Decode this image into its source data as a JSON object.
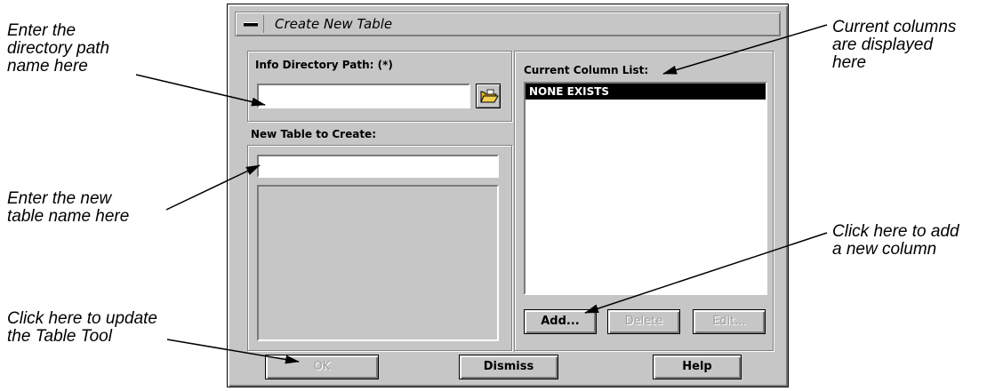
{
  "annotations": {
    "directory_path": "Enter the\ndirectory path\nname here",
    "new_table": "Enter the new\ntable name here",
    "update_tool": "Click here to update\nthe Table Tool",
    "current_columns": "Current columns\nare displayed\nhere",
    "add_column": "Click here to add\na new column"
  },
  "window": {
    "title": "Create New Table"
  },
  "info_directory": {
    "label": "Info Directory Path: (*)",
    "value": "",
    "browse_icon": "folder-open-icon"
  },
  "new_table": {
    "label": "New Table to Create:",
    "value": ""
  },
  "column_list": {
    "label": "Current Column List:",
    "items": [
      "NONE EXISTS"
    ]
  },
  "column_buttons": {
    "add": "Add...",
    "delete": "Delete",
    "edit": "Edit..."
  },
  "footer_buttons": {
    "ok": "OK",
    "dismiss": "Dismiss",
    "help": "Help"
  }
}
